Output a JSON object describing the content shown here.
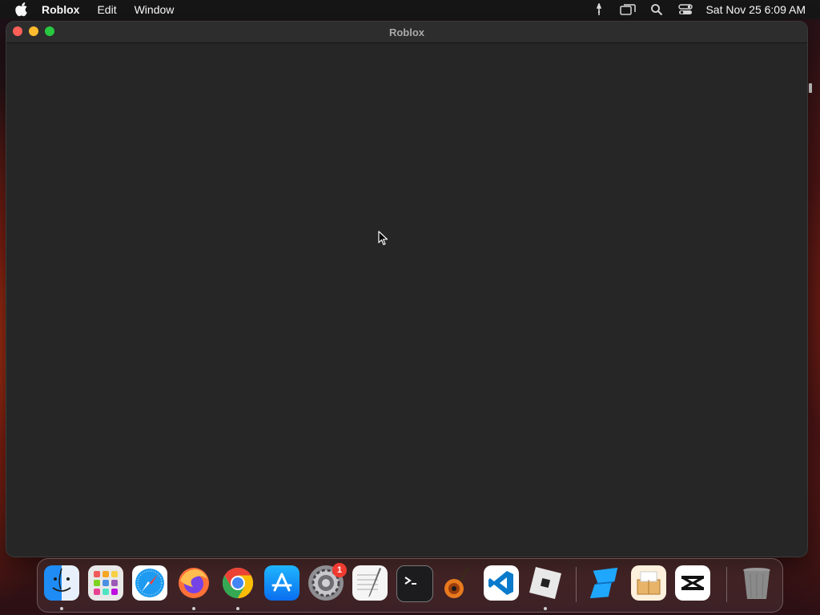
{
  "menubar": {
    "apple_icon": "apple-icon",
    "items": [
      "Roblox",
      "Edit",
      "Window"
    ],
    "status_icons": [
      "vpn-icon",
      "screen-mirroring-icon",
      "search-icon",
      "control-center-icon"
    ],
    "clock": "Sat Nov 25  6:09 AM"
  },
  "window": {
    "title": "Roblox"
  },
  "dock": {
    "apps": [
      {
        "name": "Finder",
        "icon": "finder-icon",
        "running": true
      },
      {
        "name": "Launchpad",
        "icon": "launchpad-icon",
        "running": false
      },
      {
        "name": "Safari",
        "icon": "safari-icon",
        "running": false
      },
      {
        "name": "Firefox",
        "icon": "firefox-icon",
        "running": true
      },
      {
        "name": "Google Chrome",
        "icon": "chrome-icon",
        "running": true
      },
      {
        "name": "App Store",
        "icon": "app-store-icon",
        "running": false
      },
      {
        "name": "System Settings",
        "icon": "system-settings-icon",
        "running": false,
        "badge": "1"
      },
      {
        "name": "TextEdit",
        "icon": "textedit-icon",
        "running": false
      },
      {
        "name": "Terminal",
        "icon": "terminal-icon",
        "running": false
      },
      {
        "name": "GarageBand",
        "icon": "garageband-icon",
        "running": false
      },
      {
        "name": "Visual Studio Code",
        "icon": "vscode-icon",
        "running": false
      },
      {
        "name": "Roblox",
        "icon": "roblox-icon",
        "running": true
      },
      {
        "name": "Roblox Studio",
        "icon": "roblox-studio-icon",
        "running": false
      },
      {
        "name": "Archive Utility",
        "icon": "archive-icon",
        "running": false
      },
      {
        "name": "CapCut",
        "icon": "capcut-icon",
        "running": false
      },
      {
        "name": "Trash",
        "icon": "trash-icon",
        "running": false
      }
    ]
  },
  "colors": {
    "menubar_bg": "#161616",
    "window_bg": "#262626",
    "close": "#fe5f57",
    "minimize": "#febc2e",
    "maximize": "#28c840",
    "badge": "#f23b30"
  }
}
